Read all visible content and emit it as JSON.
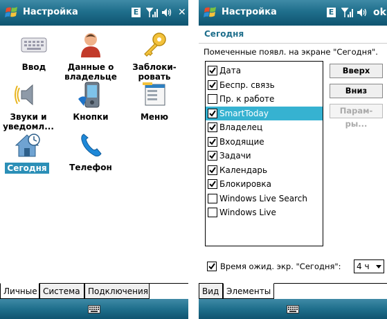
{
  "left_screen": {
    "title": "Настройка",
    "close_label": "✕",
    "items": [
      {
        "label_line1": "Ввод",
        "label_line2": ""
      },
      {
        "label_line1": "Данные о",
        "label_line2": "владельце"
      },
      {
        "label_line1": "Заблоки-",
        "label_line2": "ровать"
      },
      {
        "label_line1": "Звуки и",
        "label_line2": "уведомл..."
      },
      {
        "label_line1": "Кнопки",
        "label_line2": ""
      },
      {
        "label_line1": "Меню",
        "label_line2": ""
      },
      {
        "label_line1": "Сегодня",
        "label_line2": ""
      },
      {
        "label_line1": "Телефон",
        "label_line2": ""
      }
    ],
    "selected_item": "Сегодня",
    "tabs": [
      "Личные",
      "Система",
      "Подключения"
    ]
  },
  "right_screen": {
    "title": "Настройка",
    "ok_label": "ok",
    "page_title": "Сегодня",
    "description": "Помеченные появл. на экране \"Сегодня\".",
    "list": [
      {
        "label": "Дата",
        "checked": true
      },
      {
        "label": "Беспр. связь",
        "checked": true
      },
      {
        "label": "Пр. к работе",
        "checked": false
      },
      {
        "label": "SmartToday",
        "checked": true,
        "selected": true
      },
      {
        "label": "Владелец",
        "checked": true
      },
      {
        "label": "Входящие",
        "checked": true
      },
      {
        "label": "Задачи",
        "checked": true
      },
      {
        "label": "Календарь",
        "checked": true
      },
      {
        "label": "Блокировка",
        "checked": true
      },
      {
        "label": "Windows Live Search",
        "checked": false
      },
      {
        "label": "Windows Live",
        "checked": false
      }
    ],
    "buttons": {
      "up": "Вверх",
      "down": "Вниз",
      "options": "Парам-ры..."
    },
    "timeout_label": "Время ожид. экр. \"Сегодня\":",
    "timeout_checked": true,
    "timeout_value": "4 ч",
    "tabs": [
      "Вид",
      "Элементы"
    ]
  },
  "status": {
    "network_badge": "E"
  },
  "colors": {
    "titlebar": "#1f6f8c",
    "selection": "#36b2d1",
    "accent_text": "#1f6f8c"
  }
}
